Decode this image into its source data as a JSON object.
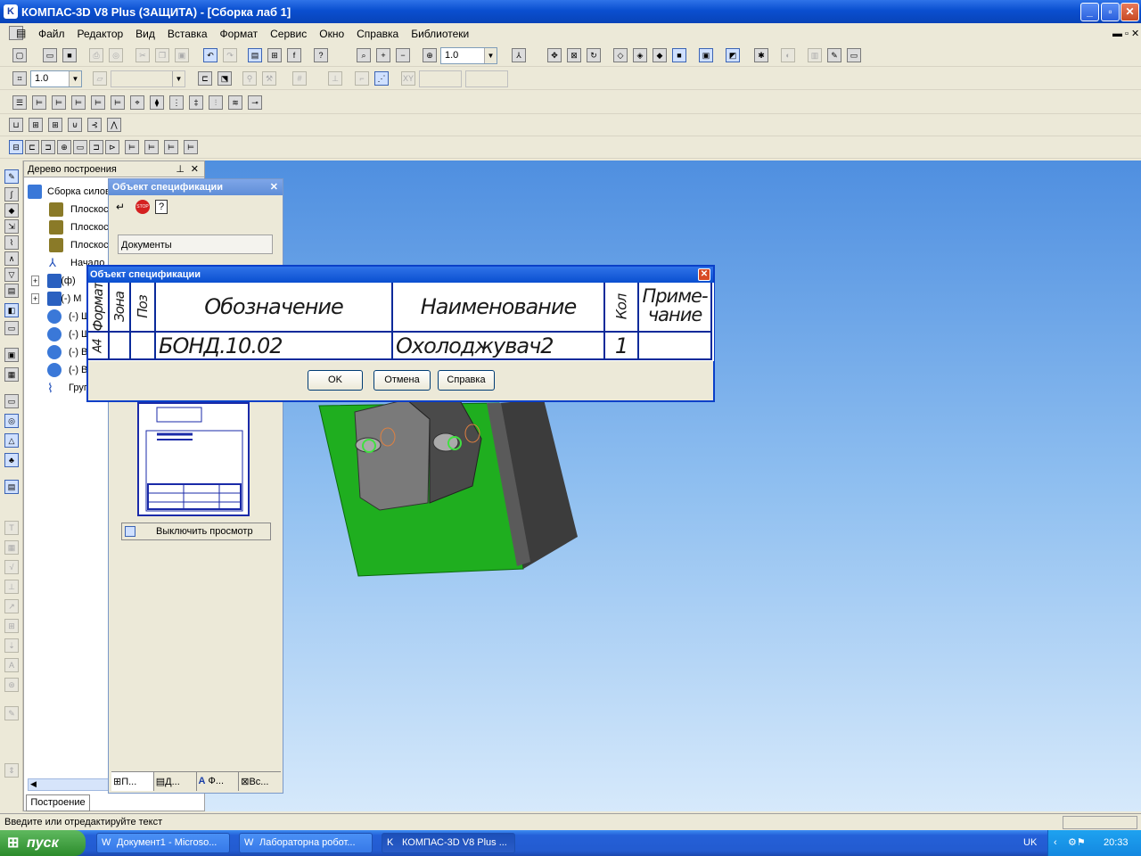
{
  "app": {
    "title": "КОМПАС-3D V8 Plus (ЗАЩИТА) - [Сборка лаб 1]"
  },
  "menu": [
    "Файл",
    "Редактор",
    "Вид",
    "Вставка",
    "Формат",
    "Сервис",
    "Окно",
    "Справка",
    "Библиотеки"
  ],
  "toolbar": {
    "zoom_value": "1.0",
    "step_value": "1.0"
  },
  "tree": {
    "title": "Дерево построения",
    "items": [
      "Сборка силов",
      "Плоскос",
      "Плоскос",
      "Плоскос",
      "Начало",
      "(ф)",
      "(-) М",
      "(-) Ш",
      "(-) Ш",
      "(-) В",
      "(-) В",
      "Груп"
    ],
    "tab": "Построение"
  },
  "spec_panel": {
    "title": "Объект спецификации",
    "docs_label": "Документы",
    "preview_toggle": "Выключить просмотр",
    "tabs": [
      "П...",
      "Д...",
      "Ф...",
      "Вс..."
    ]
  },
  "dialog": {
    "title": "Объект спецификации",
    "headers": {
      "format": "Формат",
      "zone": "Зона",
      "pos": "Поз",
      "designation": "Обозначение",
      "name": "Наименование",
      "qty": "Кол",
      "note1": "Приме-",
      "note2": "чание"
    },
    "row": {
      "format": "А4",
      "zone": "",
      "pos": "",
      "designation": "БОНД.10.02",
      "name": "Охолоджувач2",
      "qty": "1",
      "note": ""
    },
    "buttons": {
      "ok": "OK",
      "cancel": "Отмена",
      "help": "Справка"
    }
  },
  "status": {
    "text": "Введите или отредактируйте текст"
  },
  "taskbar": {
    "start": "пуск",
    "tasks": [
      "Документ1 - Microso...",
      "Лабораторна робот...",
      "КОМПАС-3D V8 Plus ..."
    ],
    "lang": "UK",
    "clock": "20:33"
  },
  "colors": {
    "title_blue": "#0a4fd0",
    "part_green": "#1fae1f",
    "taskbar_blue": "#235bd0"
  }
}
